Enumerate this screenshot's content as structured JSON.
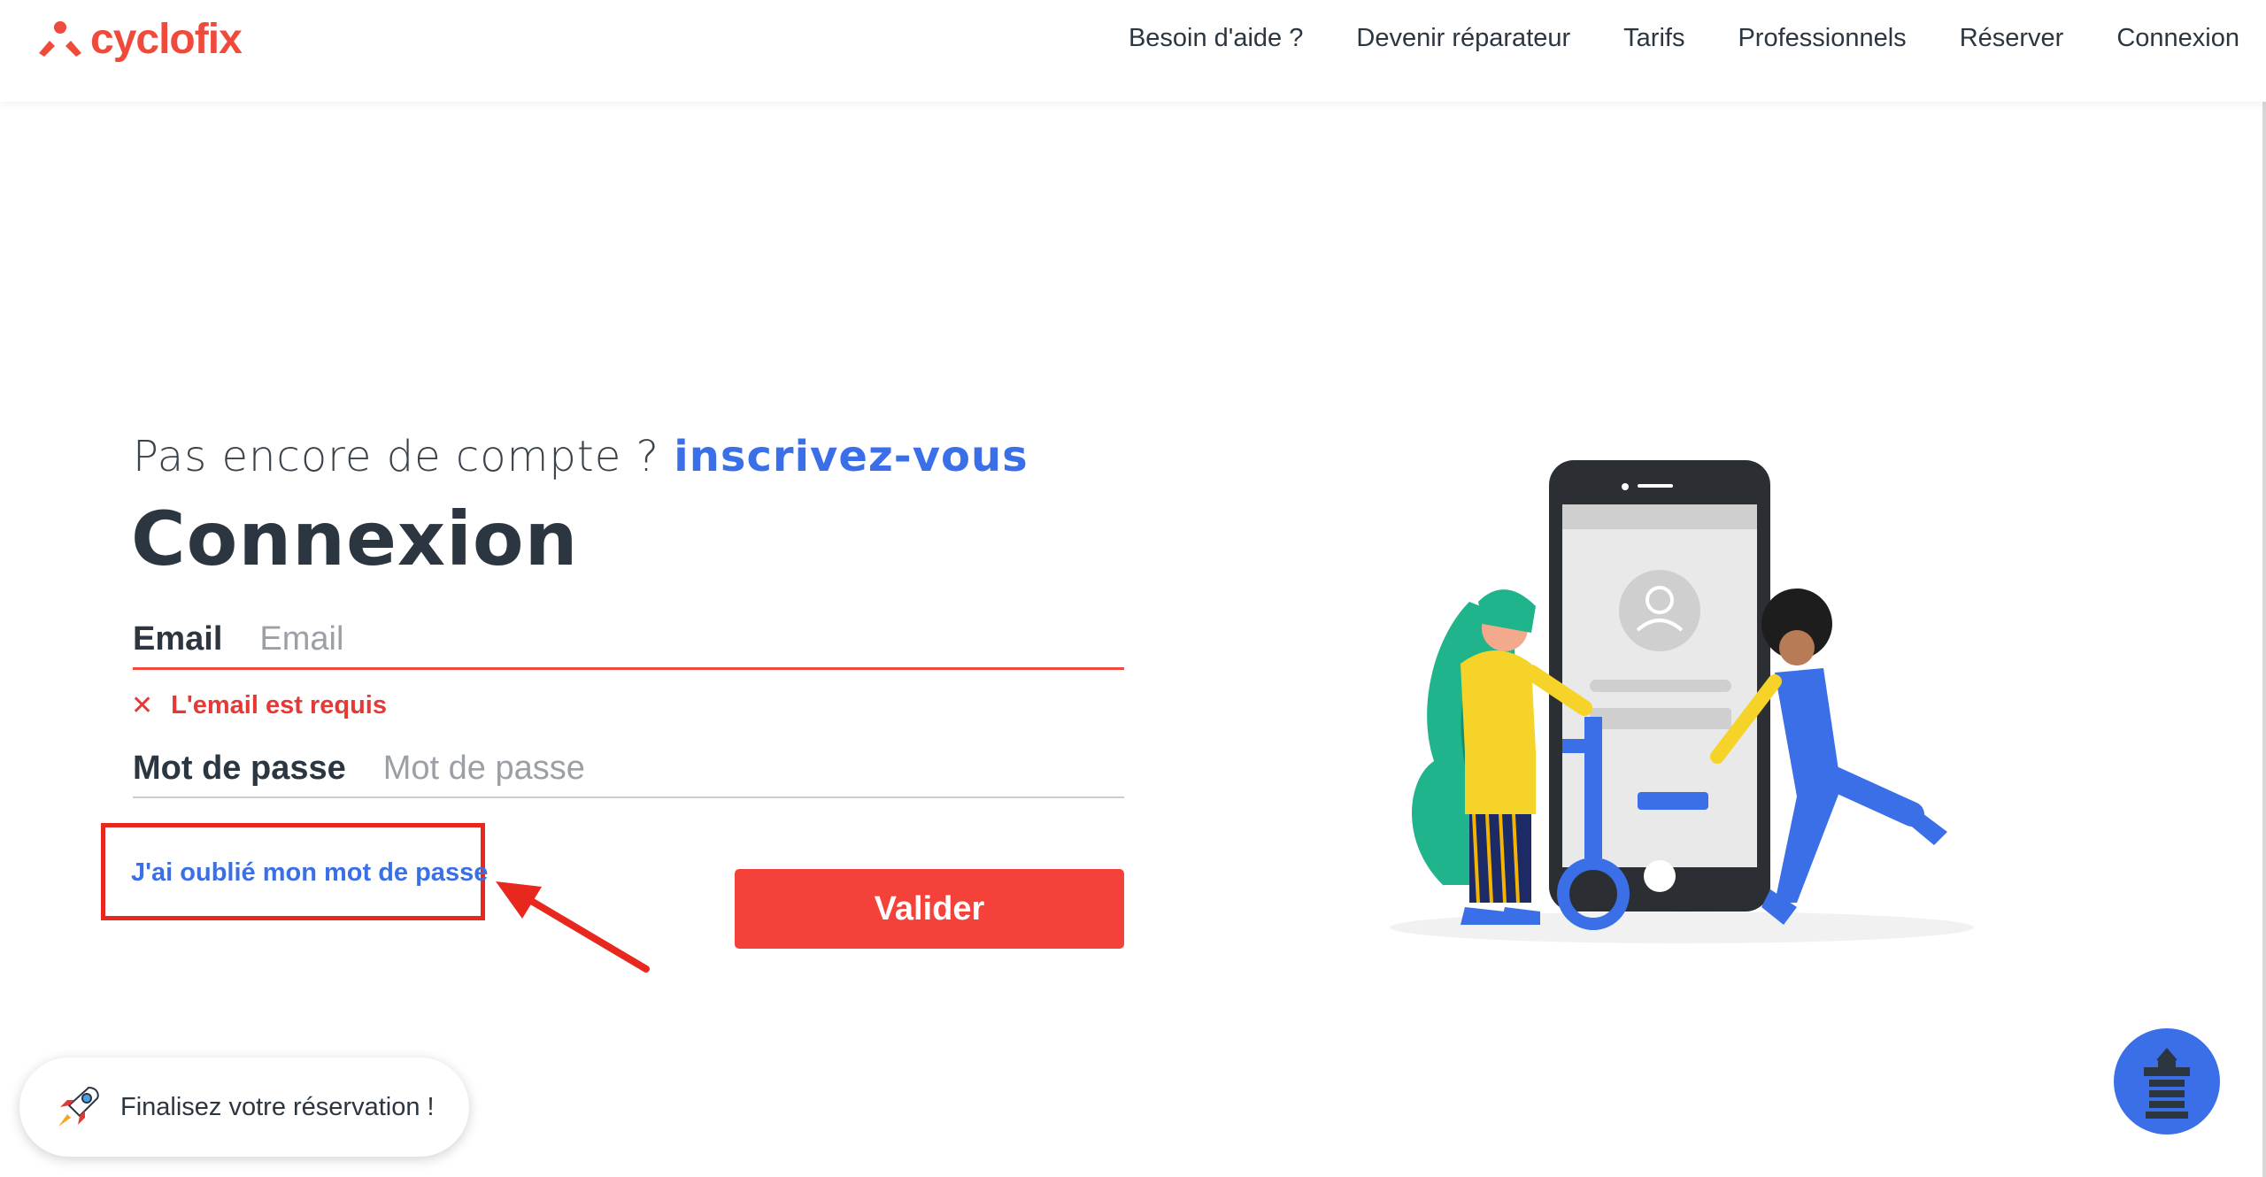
{
  "brand": {
    "name": "cyclofix",
    "color": "#f04a3c"
  },
  "nav": [
    {
      "label": "Besoin d'aide ?"
    },
    {
      "label": "Devenir réparateur"
    },
    {
      "label": "Tarifs"
    },
    {
      "label": "Professionnels"
    },
    {
      "label": "Réserver"
    },
    {
      "label": "Connexion"
    }
  ],
  "signup": {
    "prompt": "Pas encore de compte ?",
    "link": "inscrivez-vous"
  },
  "title": "Connexion",
  "form": {
    "email_label": "Email",
    "email_placeholder": "Email",
    "email_error": "L'email est requis",
    "password_label": "Mot de passe",
    "password_placeholder": "Mot de passe",
    "forgot": "J'ai oublié mon mot de passe",
    "submit": "Valider"
  },
  "widget": {
    "label": "Finalisez votre réservation !"
  },
  "colors": {
    "accent": "#3a6fe8",
    "error": "#e53935",
    "submit": "#f4413a"
  }
}
